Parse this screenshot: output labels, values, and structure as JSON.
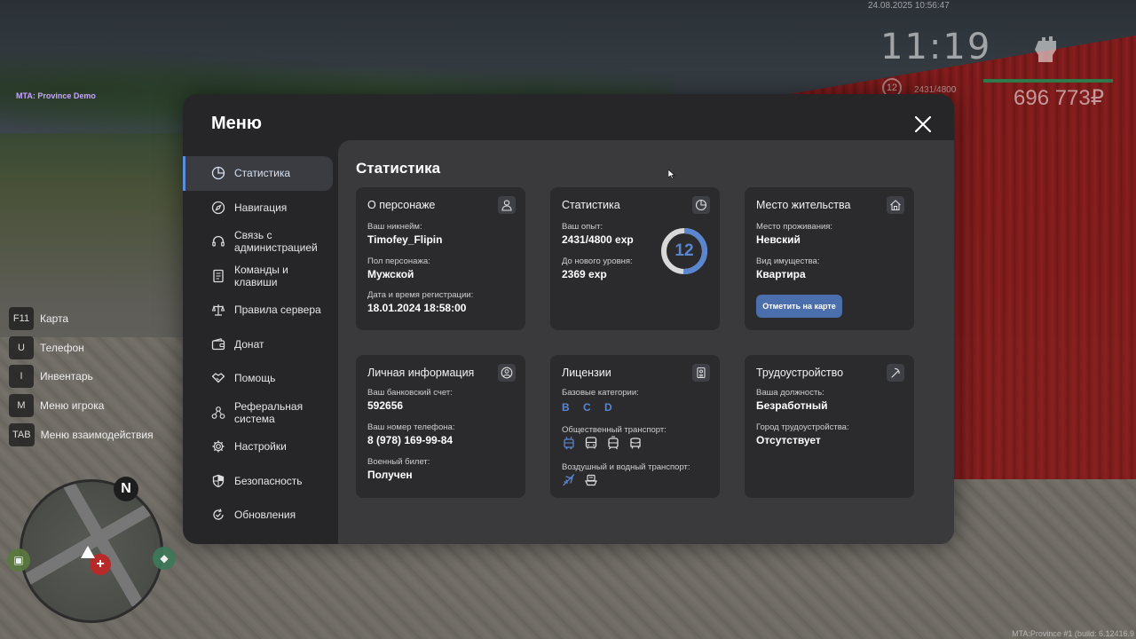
{
  "hud": {
    "server_name": "MTA: Province Demo",
    "datetime": "24.08.2025 10:56:47",
    "time": "11:19",
    "level": "12",
    "exp": "2431/4800",
    "money": "696 773₽",
    "build": "MTA:Province #1 (build: 6.12416.9"
  },
  "hints": [
    {
      "key": "F11",
      "label": "Карта"
    },
    {
      "key": "U",
      "label": "Телефон"
    },
    {
      "key": "I",
      "label": "Инвентарь"
    },
    {
      "key": "M",
      "label": "Меню игрока"
    },
    {
      "key": "TAB",
      "label": "Меню взаимодействия"
    }
  ],
  "minimap": {
    "north": "N"
  },
  "menu": {
    "title": "Меню",
    "sidebar": [
      {
        "label": "Статистика",
        "icon": "pie-chart-icon",
        "active": true
      },
      {
        "label": "Навигация",
        "icon": "compass-icon"
      },
      {
        "label": "Связь с администрацией",
        "icon": "headset-icon"
      },
      {
        "label": "Команды и клавиши",
        "icon": "document-icon"
      },
      {
        "label": "Правила сервера",
        "icon": "scales-icon"
      },
      {
        "label": "Донат",
        "icon": "wallet-icon"
      },
      {
        "label": "Помощь",
        "icon": "handshake-icon"
      },
      {
        "label": "Реферальная система",
        "icon": "people-network-icon"
      },
      {
        "label": "Настройки",
        "icon": "gear-icon"
      },
      {
        "label": "Безопасность",
        "icon": "shield-icon"
      },
      {
        "label": "Обновления",
        "icon": "refresh-icon"
      }
    ],
    "content_title": "Статистика",
    "cards": {
      "character": {
        "title": "О персонаже",
        "nick_label": "Ваш никнейм:",
        "nick": "Timofey_Flipin",
        "gender_label": "Пол персонажа:",
        "gender": "Мужской",
        "reg_label": "Дата и время регистрации:",
        "reg": "18.01.2024 18:58:00"
      },
      "stats": {
        "title": "Статистика",
        "exp_label": "Ваш опыт:",
        "exp": "2431/4800 exp",
        "next_label": "До нового уровня:",
        "next": "2369 exp",
        "level": "12",
        "progress": 0.506
      },
      "residence": {
        "title": "Место жительства",
        "place_label": "Место проживания:",
        "place": "Невский",
        "type_label": "Вид имущества:",
        "type": "Квартира",
        "button": "Отметить на карте"
      },
      "personal": {
        "title": "Личная информация",
        "bank_label": "Ваш банковский счет:",
        "bank": "592656",
        "phone_label": "Ваш номер телефона:",
        "phone": "8 (978) 169-99-84",
        "military_label": "Военный билет:",
        "military": "Получен"
      },
      "licenses": {
        "title": "Лицензии",
        "base_label": "Базовые категории:",
        "base": "B C D",
        "public_label": "Общественный транспорт:",
        "public_icons": [
          "trolleybus-icon",
          "bus-icon",
          "tram-icon",
          "minibus-icon"
        ],
        "air_label": "Воздушный и водный транспорт:",
        "air_icons": [
          "plane-icon",
          "boat-icon"
        ]
      },
      "job": {
        "title": "Трудоустройство",
        "position_label": "Ваша должность:",
        "position": "Безработный",
        "city_label": "Город трудоустройства:",
        "city": "Отсутствует"
      }
    }
  },
  "colors": {
    "accent": "#5a86cf",
    "button": "#4b6fad",
    "panel": "#262628",
    "card": "#2b2b2d",
    "content": "#3a3a3c"
  }
}
